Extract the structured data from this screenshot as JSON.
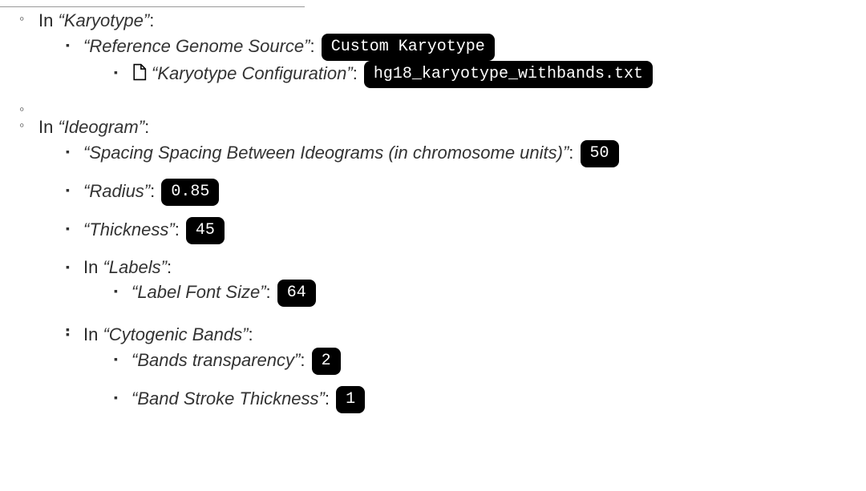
{
  "karyotype": {
    "section_prefix": "In ",
    "section_name": "“Karyotype”",
    "section_suffix": ":",
    "ref_genome_label": "“Reference Genome Source”",
    "ref_genome_value": "Custom Karyotype",
    "karyotype_config_label": "“Karyotype Configuration”",
    "karyotype_config_value": "hg18_karyotype_withbands.txt"
  },
  "ideogram": {
    "section_prefix": "In ",
    "section_name": "“Ideogram”",
    "section_suffix": ":",
    "spacing_label": "“Spacing Spacing Between Ideograms (in chromosome units)”",
    "spacing_value": "50",
    "radius_label": "“Radius”",
    "radius_value": "0.85",
    "thickness_label": "“Thickness”",
    "thickness_value": "45",
    "labels_prefix": "In ",
    "labels_name": "“Labels”",
    "labels_suffix": ":",
    "label_font_size_label": "“Label Font Size”",
    "label_font_size_value": "64",
    "cytogenic_prefix": "In ",
    "cytogenic_name": "“Cytogenic Bands”",
    "cytogenic_suffix": ":",
    "bands_transparency_label": "“Bands transparency”",
    "bands_transparency_value": "2",
    "band_stroke_label": "“Band Stroke Thickness”",
    "band_stroke_value": "1"
  }
}
